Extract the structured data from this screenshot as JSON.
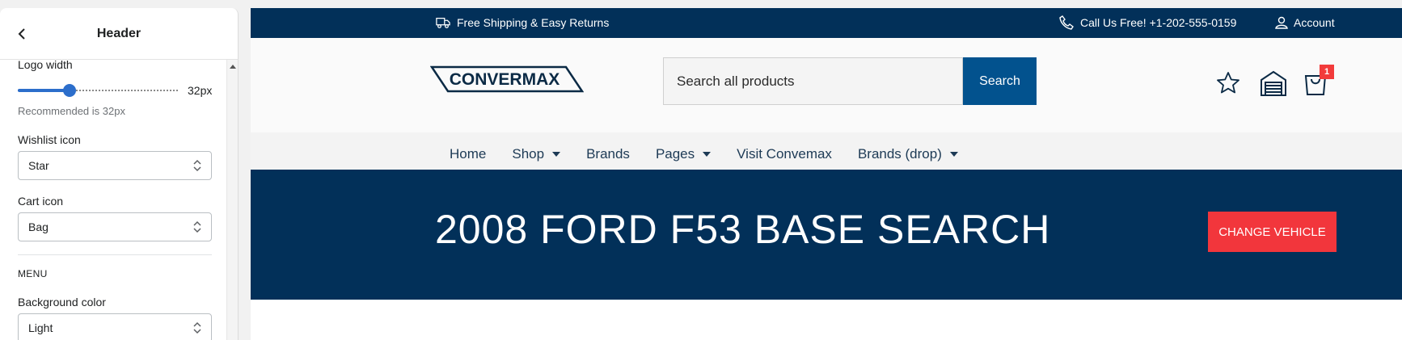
{
  "sidebar": {
    "title": "Header",
    "logo_width": {
      "label": "Logo width",
      "value": 32,
      "min": 0,
      "max": 100,
      "value_text": "32px",
      "hint": "Recommended is 32px"
    },
    "wishlist_icon": {
      "label": "Wishlist icon",
      "value": "Star"
    },
    "cart_icon": {
      "label": "Cart icon",
      "value": "Bag"
    },
    "menu_section": "MENU",
    "background_color": {
      "label": "Background color",
      "value": "Light"
    }
  },
  "store": {
    "topbar": {
      "shipping": "Free Shipping & Easy Returns",
      "call": "Call Us Free! +1-202-555-0159",
      "account": "Account"
    },
    "logo_text": "CONVERMAX",
    "search": {
      "placeholder": "Search all products",
      "button": "Search"
    },
    "cart_count": "1",
    "nav": [
      {
        "label": "Home",
        "dropdown": false
      },
      {
        "label": "Shop",
        "dropdown": true
      },
      {
        "label": "Brands",
        "dropdown": false
      },
      {
        "label": "Pages",
        "dropdown": true
      },
      {
        "label": "Visit Convemax",
        "dropdown": false
      },
      {
        "label": "Brands (drop)",
        "dropdown": true
      }
    ],
    "banner": {
      "title": "2008 FORD F53 BASE SEARCH",
      "button": "CHANGE VEHICLE"
    }
  },
  "colors": {
    "brand_navy": "#023059",
    "search_blue": "#02528e",
    "accent_red": "#f2363c",
    "slider_blue": "#2c6ecb"
  }
}
